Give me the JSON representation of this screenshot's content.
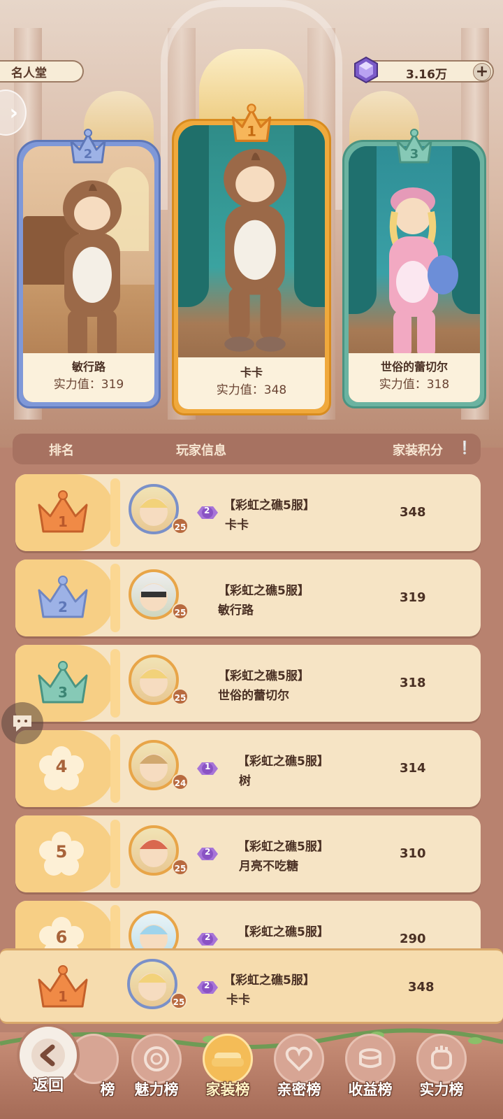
{
  "header": {
    "hall_title": "名人堂",
    "currency_value": "3.16万",
    "currency_icon": "purple-gem-icon",
    "add_icon": "plus-icon"
  },
  "podium": [
    {
      "rank": "2",
      "name": "敏行路",
      "power": "实力值：319",
      "frame_color": "#7f98d8"
    },
    {
      "rank": "1",
      "name": "卡卡",
      "power": "实力值：348",
      "frame_color": "#f0a93c"
    },
    {
      "rank": "3",
      "name": "世俗的蕾切尔",
      "power": "实力值：318",
      "frame_color": "#6bb3a1"
    }
  ],
  "table_header": {
    "rank": "排名",
    "player": "玩家信息",
    "score": "家装积分",
    "info_icon": "exclamation-icon"
  },
  "rows": [
    {
      "rank": "1",
      "vip": "2",
      "level": "25",
      "server": "【彩虹之礁5服】",
      "name": "卡卡",
      "score": "348"
    },
    {
      "rank": "2",
      "vip": "",
      "level": "25",
      "server": "【彩虹之礁5服】",
      "name": "敏行路",
      "score": "319"
    },
    {
      "rank": "3",
      "vip": "",
      "level": "25",
      "server": "【彩虹之礁5服】",
      "name": "世俗的蕾切尔",
      "score": "318"
    },
    {
      "rank": "4",
      "vip": "1",
      "level": "24",
      "server": "【彩虹之礁5服】",
      "name": "树",
      "score": "314"
    },
    {
      "rank": "5",
      "vip": "2",
      "level": "25",
      "server": "【彩虹之礁5服】",
      "name": "月亮不吃糖",
      "score": "310"
    },
    {
      "rank": "6",
      "vip": "2",
      "level": "",
      "server": "【彩虹之礁5服】",
      "name": "",
      "score": "290"
    }
  ],
  "my_row": {
    "rank": "1",
    "vip": "2",
    "level": "25",
    "server": "【彩虹之礁5服】",
    "name": "卡卡",
    "score": "348"
  },
  "nav": {
    "back": "返回",
    "tabs": [
      "榜",
      "魅力榜",
      "家装榜",
      "亲密榜",
      "收益榜",
      "实力榜"
    ],
    "active_tab": "家装榜"
  },
  "colors": {
    "gold": "#f0a93c",
    "silver": "#7f98d8",
    "bronze": "#6bb3a1",
    "row_bg": "#f6e4c5",
    "page_bg": "#b8826f"
  }
}
